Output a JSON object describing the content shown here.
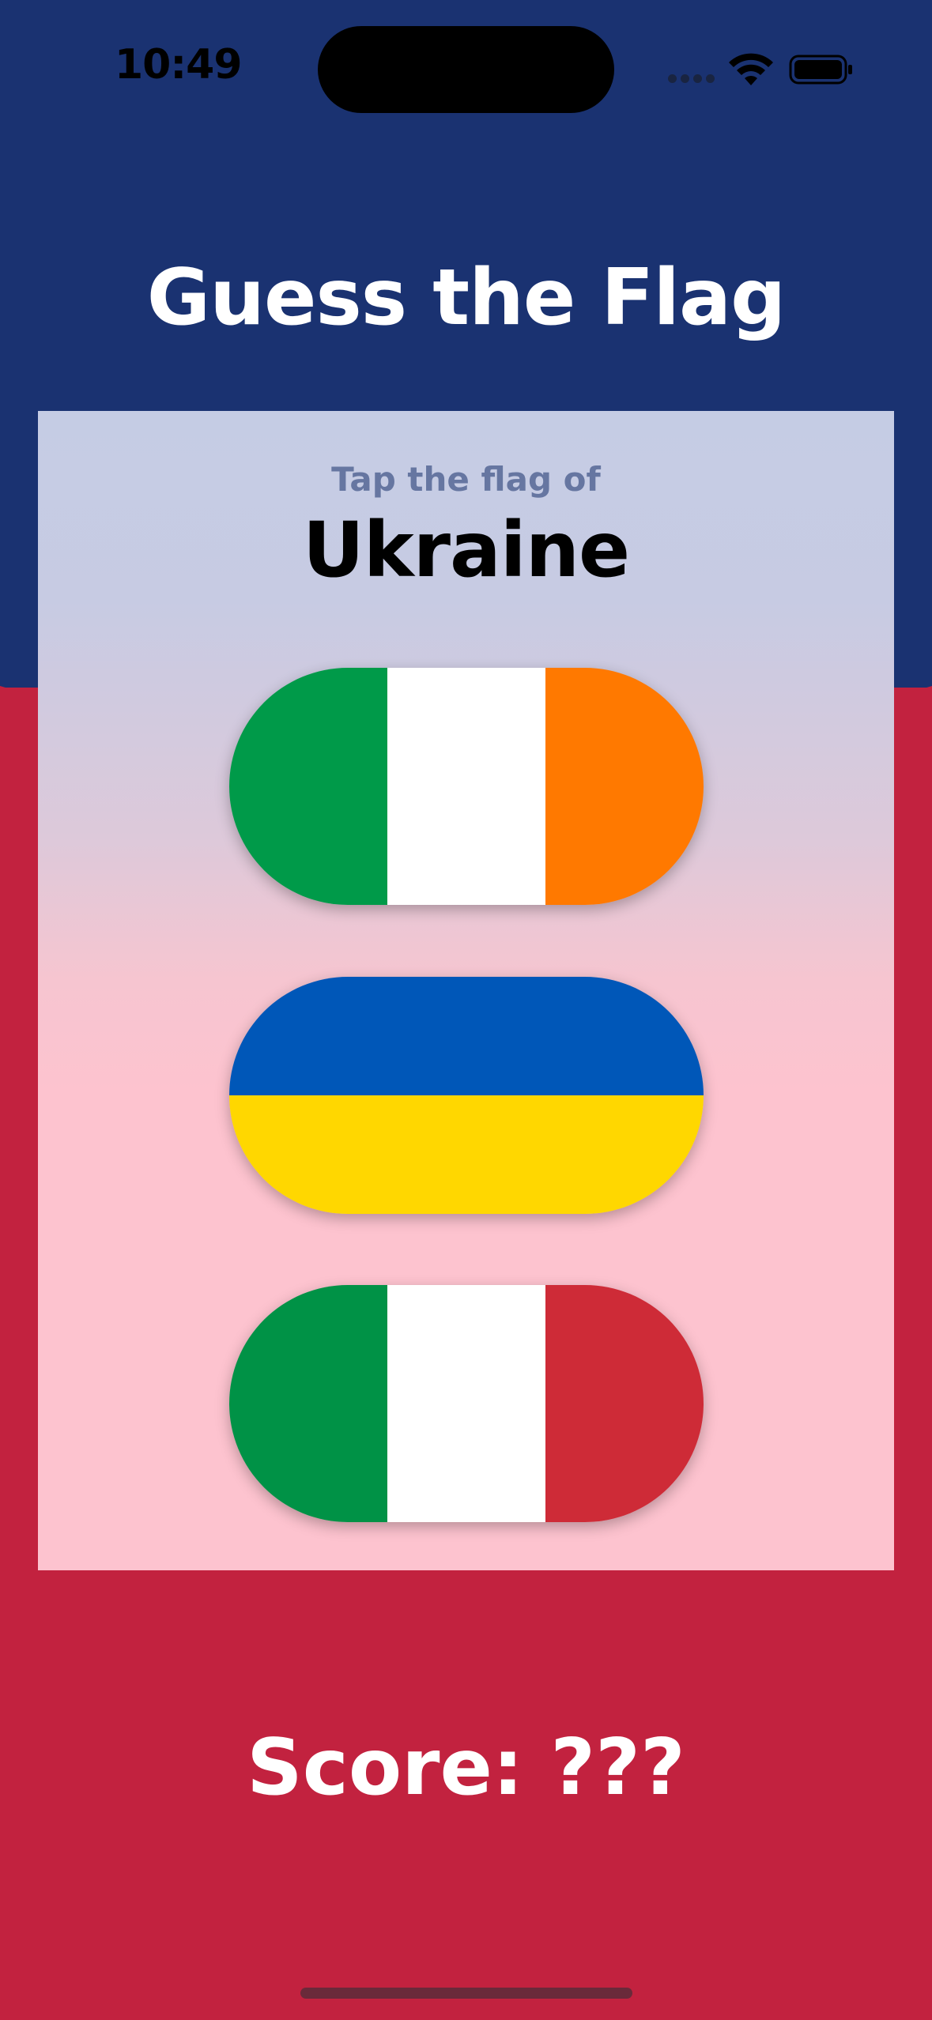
{
  "status_bar": {
    "time": "10:49",
    "icons": [
      "signal-dots-icon",
      "wifi-icon",
      "battery-icon"
    ]
  },
  "header": {
    "title": "Guess the Flag"
  },
  "question": {
    "prompt": "Tap the flag of",
    "country": "Ukraine"
  },
  "flags": [
    {
      "name": "ireland-flag",
      "layout": "vertical",
      "colors": [
        "#009a49",
        "#ffffff",
        "#ff7900"
      ]
    },
    {
      "name": "ukraine-flag",
      "layout": "horizontal",
      "colors": [
        "#0057b8",
        "#ffd700"
      ]
    },
    {
      "name": "italy-flag",
      "layout": "vertical",
      "colors": [
        "#009246",
        "#ffffff",
        "#ce2b37"
      ]
    }
  ],
  "footer": {
    "score": "Score: ???"
  },
  "theme": {
    "top_background": "#1a3271",
    "bottom_background": "#c2223f"
  }
}
